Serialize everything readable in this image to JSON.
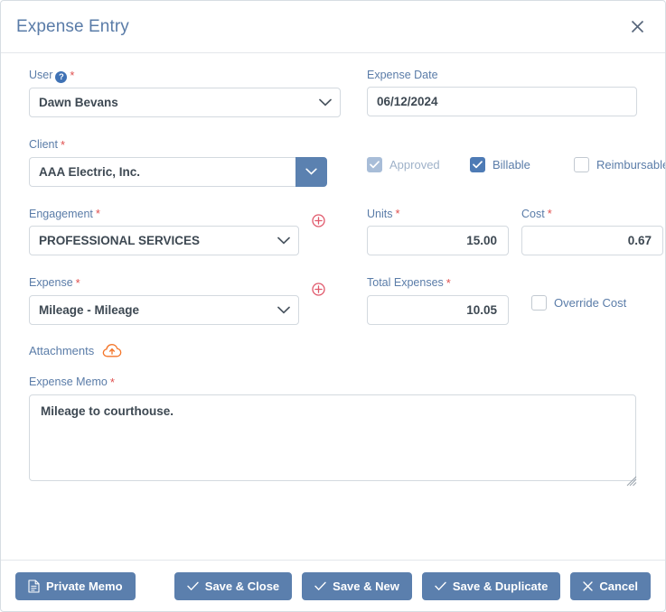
{
  "dialog": {
    "title": "Expense Entry",
    "close_icon": "close-icon"
  },
  "fields": {
    "user": {
      "label": "User",
      "required": true,
      "help_icon": "?",
      "value": "Dawn Bevans"
    },
    "expense_date": {
      "label": "Expense Date",
      "value": "06/12/2024"
    },
    "client": {
      "label": "Client",
      "required": true,
      "value": "AAA Electric, Inc."
    },
    "engagement": {
      "label": "Engagement",
      "required": true,
      "value": "PROFESSIONAL SERVICES",
      "add_icon": "circle-plus-icon"
    },
    "expense": {
      "label": "Expense",
      "required": true,
      "value": "Mileage - Mileage",
      "add_icon": "circle-plus-icon"
    },
    "units": {
      "label": "Units",
      "required": true,
      "value": "15.00"
    },
    "cost": {
      "label": "Cost",
      "required": true,
      "value": "0.67"
    },
    "total_expenses": {
      "label": "Total Expenses",
      "required": true,
      "value": "10.05"
    },
    "expense_memo": {
      "label": "Expense Memo",
      "required": true,
      "value": "Mileage to courthouse."
    },
    "attachments": {
      "label": "Attachments",
      "upload_icon": "cloud-upload-icon"
    }
  },
  "checkboxes": {
    "approved": {
      "label": "Approved",
      "checked": true,
      "disabled": true
    },
    "billable": {
      "label": "Billable",
      "checked": true,
      "disabled": false
    },
    "reimbursable": {
      "label": "Reimbursable",
      "checked": false,
      "disabled": false
    },
    "override_cost": {
      "label": "Override Cost",
      "checked": false,
      "disabled": false
    }
  },
  "footer": {
    "private_memo": "Private Memo",
    "save_close": "Save & Close",
    "save_new": "Save & New",
    "save_duplicate": "Save & Duplicate",
    "cancel": "Cancel"
  },
  "colors": {
    "accent_blue": "#5a7ca8",
    "button_blue": "#5b7fad",
    "dropdown_blue": "#5b81b0",
    "checkbox_checked": "#4e7bb5",
    "checkbox_disabled": "#a8bdd8",
    "required_red": "#e0504f",
    "plus_red": "#e0576a",
    "upload_orange": "#f4762a"
  }
}
